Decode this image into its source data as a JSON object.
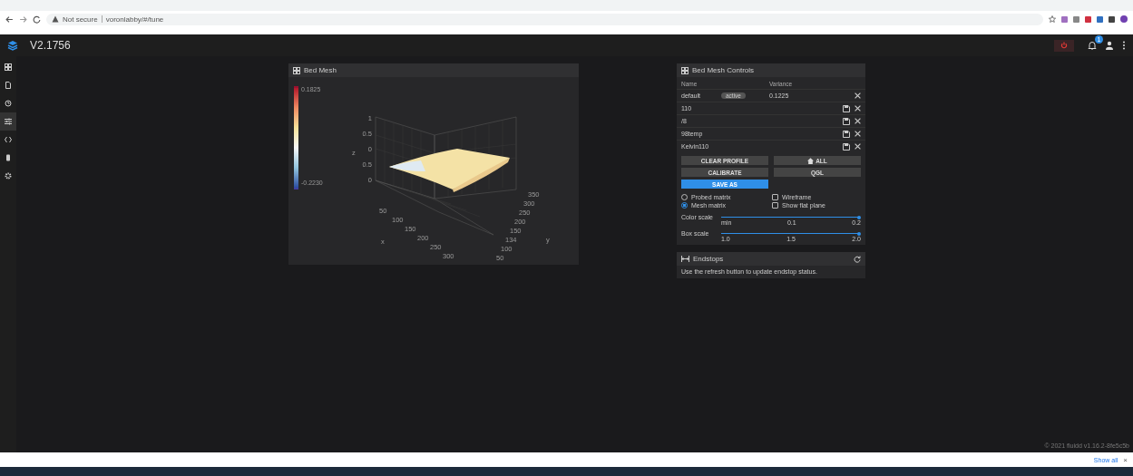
{
  "browser": {
    "security": "Not secure",
    "url": "voronlabby/#/tune",
    "show_all": "Show all",
    "close": "×"
  },
  "app": {
    "title": "V2.1756",
    "notifications": "1"
  },
  "sidebar": {
    "items": [
      {
        "selected": false
      },
      {
        "selected": false
      },
      {
        "selected": false
      },
      {
        "selected": true
      },
      {
        "selected": false
      },
      {
        "selected": false
      },
      {
        "selected": false
      }
    ]
  },
  "bed_mesh": {
    "title": "Bed Mesh",
    "scale_max": "0.1825",
    "scale_min": "-0.2230",
    "plot": {
      "z_ticks": [
        "1",
        "0.5",
        "0",
        "0.5",
        "0"
      ],
      "z_label": "z",
      "x_ticks": [
        "50",
        "100",
        "150",
        "200",
        "250",
        "300"
      ],
      "x_label": "x",
      "y_ticks": [
        "350",
        "300",
        "250",
        "200",
        "150",
        "134",
        "100",
        "50"
      ],
      "y_label": "y"
    }
  },
  "controls": {
    "title": "Bed Mesh Controls",
    "columns": [
      "Name",
      "Variance"
    ],
    "profiles": [
      {
        "name": "default",
        "badge": "active",
        "variance": "0.1225",
        "saveable": false
      },
      {
        "name": "110",
        "saveable": true
      },
      {
        "name": "/8",
        "saveable": true
      },
      {
        "name": "98temp",
        "saveable": true
      },
      {
        "name": "Kelvin110",
        "saveable": true
      }
    ],
    "buttons": [
      {
        "label": "CLEAR PROFILE",
        "kind": "plain"
      },
      {
        "label": "ALL",
        "kind": "home"
      },
      {
        "label": "CALIBRATE",
        "kind": "plain"
      },
      {
        "label": "QGL",
        "kind": "plain"
      },
      {
        "label": "SAVE AS",
        "kind": "primary"
      }
    ],
    "options": [
      {
        "label": "Probed matrix",
        "kind": "radio",
        "selected": false
      },
      {
        "label": "Wireframe",
        "kind": "checkbox",
        "checked": false
      },
      {
        "label": "Mesh matrix",
        "kind": "radio",
        "selected": true
      },
      {
        "label": "Show flat plane",
        "kind": "checkbox",
        "checked": false
      }
    ],
    "sliders": [
      {
        "label": "Color scale",
        "level": 1,
        "ticks": [
          "min",
          "0.1",
          "0.2"
        ]
      },
      {
        "label": "Box scale",
        "level": 1,
        "ticks": [
          "1.0",
          "1.5",
          "2.0"
        ]
      }
    ]
  },
  "endstops": {
    "title": "Endstops",
    "message": "Use the refresh button to update endstop status."
  },
  "footer": "© 2021 fluidd v1.16.2-8fe5c5b"
}
